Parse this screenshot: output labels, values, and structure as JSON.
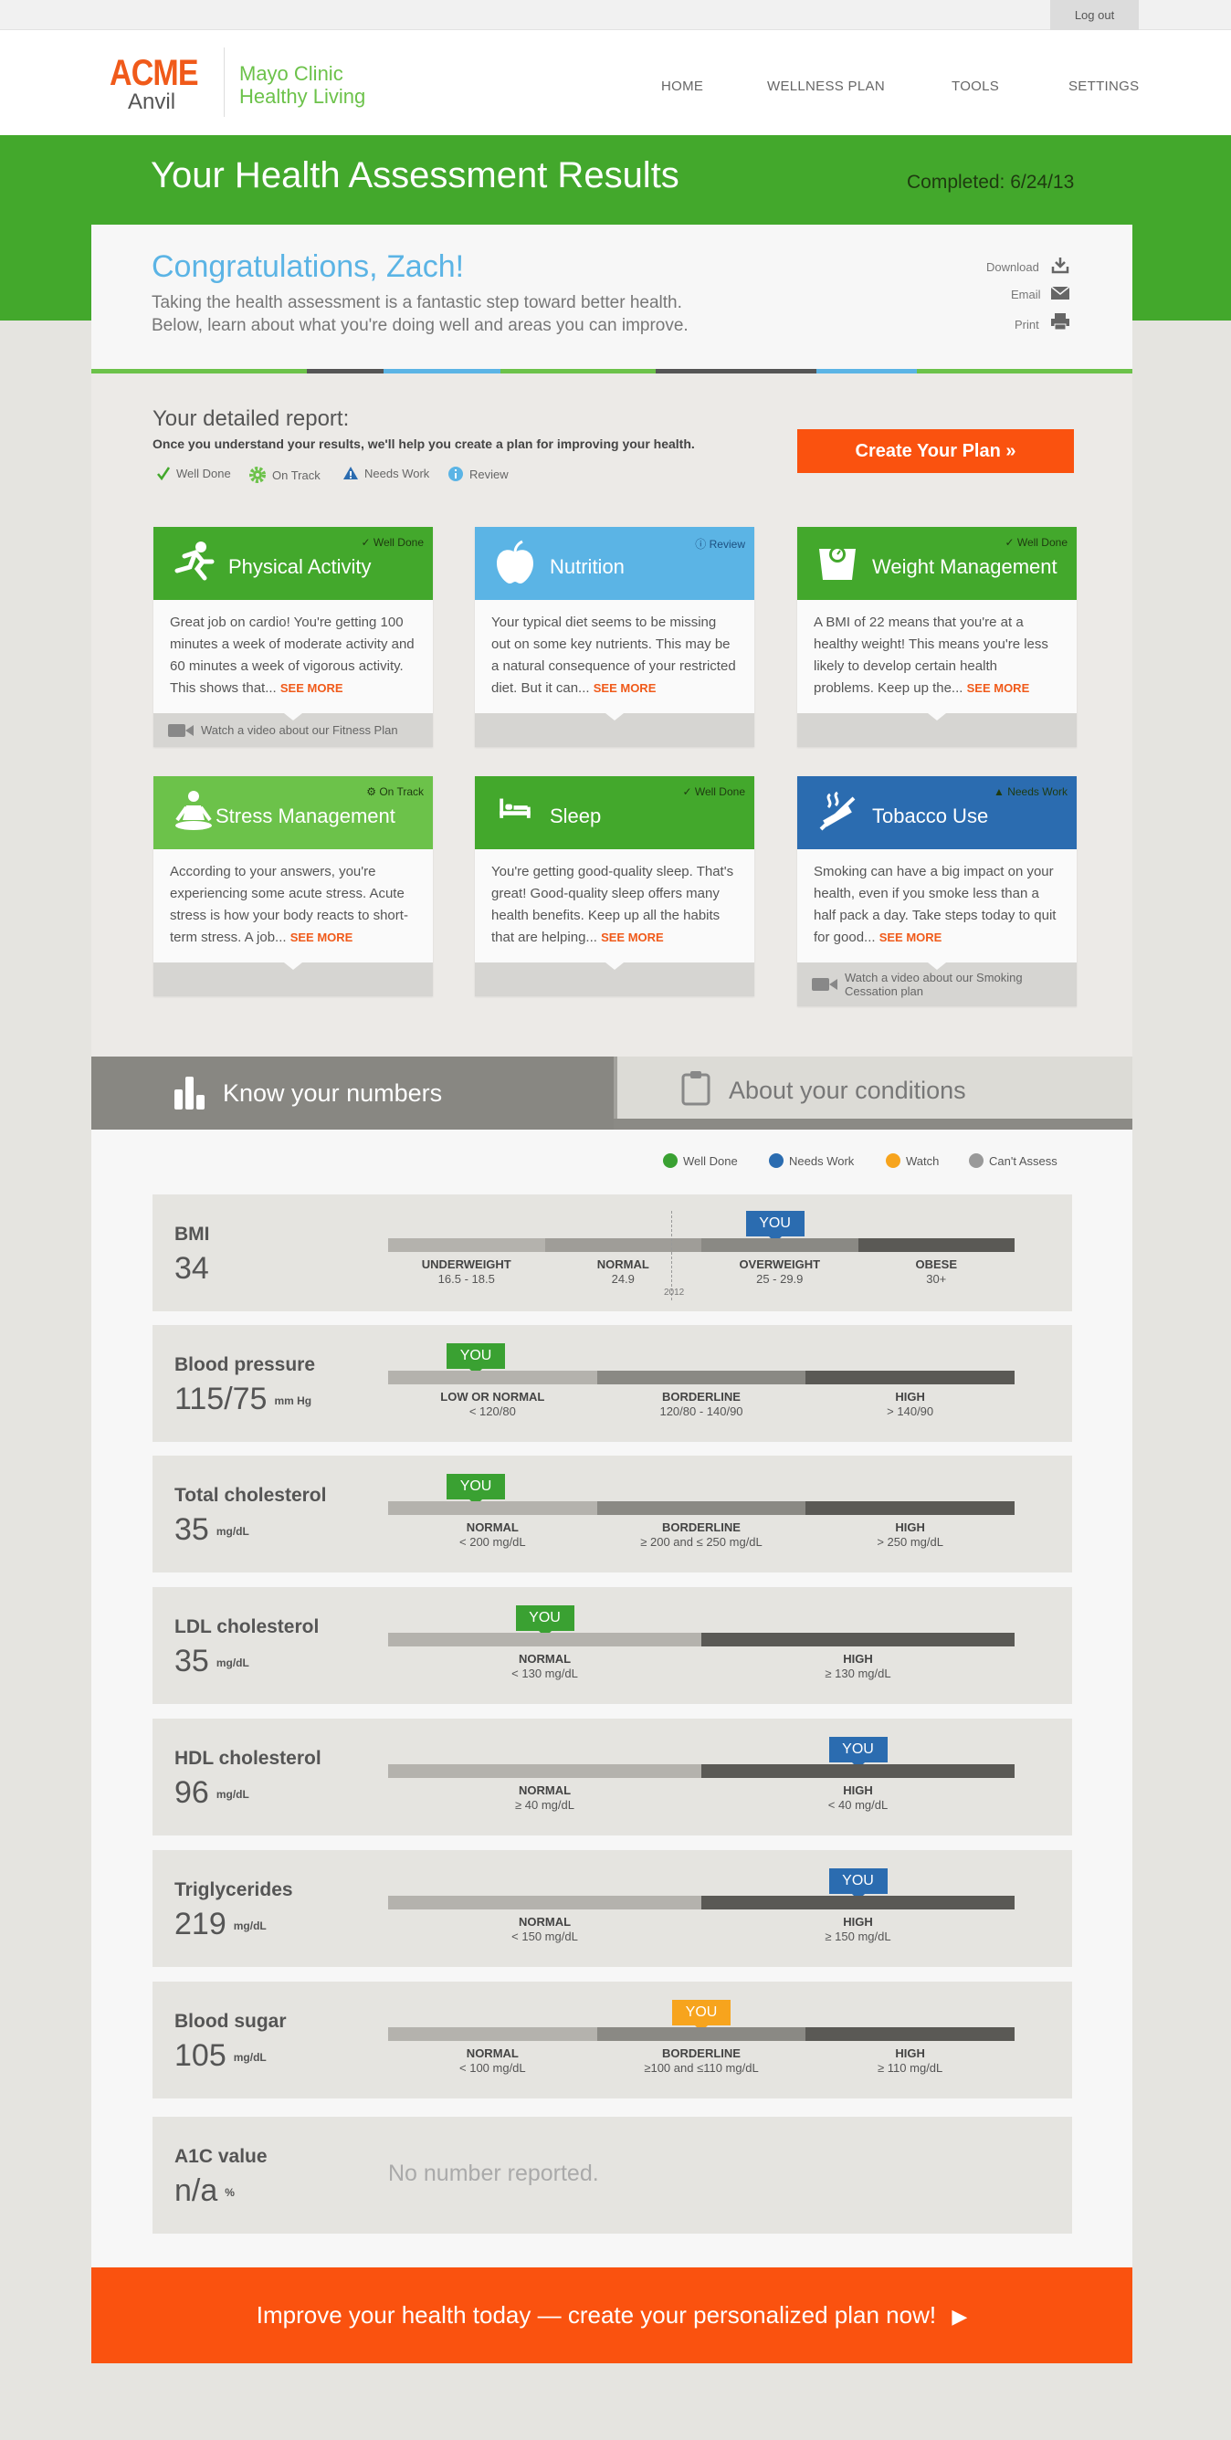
{
  "topbar": {
    "logout": "Log out"
  },
  "brand": {
    "acme": "ACME",
    "anvil": "Anvil",
    "partner_line1": "Mayo Clinic",
    "partner_line2": "Healthy Living"
  },
  "nav": [
    "HOME",
    "WELLNESS PLAN",
    "TOOLS",
    "SETTINGS"
  ],
  "page": {
    "title": "Your Health Assessment Results",
    "completed": "Completed: 6/24/13"
  },
  "intro": {
    "greeting": "Congratulations, Zach!",
    "line1": "Taking the health assessment is a fantastic step toward better health.",
    "line2": "Below, learn about what you're doing well and areas you can improve.",
    "actions": [
      "Download",
      "Email",
      "Print"
    ]
  },
  "report": {
    "title": "Your detailed report:",
    "subtitle": "Once you understand your results, we'll help you create a plan for improving your health.",
    "legend": [
      "Well Done",
      "On Track",
      "Needs Work",
      "Review"
    ],
    "create_button": "Create Your Plan »"
  },
  "topics": [
    {
      "name": "Physical Activity",
      "status": "Well Done",
      "color": "#43a82c",
      "text": "Great job on cardio! You're getting 100 minutes a week of moderate activity and 60 minutes a week of vigorous activity. This shows that...",
      "more": "SEE MORE",
      "video": "Watch a video about our Fitness Plan"
    },
    {
      "name": "Nutrition",
      "status": "Review",
      "color": "#5bb4e5",
      "text": "Your typical diet seems to be missing out on some key nutrients. This may be a natural consequence of your restricted diet. But it can...",
      "more": "SEE MORE",
      "video": ""
    },
    {
      "name": "Weight Management",
      "status": "Well Done",
      "color": "#43a82c",
      "text": "A BMI of 22 means that you're at a healthy weight! This means you're less likely to develop certain health problems. Keep up the...",
      "more": "SEE MORE",
      "video": ""
    },
    {
      "name": "Stress Management",
      "status": "On Track",
      "color": "#6cc24a",
      "text": "According to your answers, you're experiencing some acute stress. Acute stress is how your body reacts to short-term stress. A job...",
      "more": "SEE MORE",
      "video": ""
    },
    {
      "name": "Sleep",
      "status": "Well Done",
      "color": "#43a82c",
      "text": "You're getting good-quality sleep. That's great! Good-quality sleep offers many health benefits. Keep up all the habits that are helping...",
      "more": "SEE MORE",
      "video": ""
    },
    {
      "name": "Tobacco Use",
      "status": "Needs Work",
      "color": "#2b6cb0",
      "text": "Smoking can have a big impact on your health, even if you smoke less than a half pack a day. Take steps today to quit for good...",
      "more": "SEE MORE",
      "video": "Watch a video about our Smoking Cessation plan"
    }
  ],
  "tabs": {
    "numbers": "Know your numbers",
    "conditions": "About your conditions"
  },
  "status_legend": [
    {
      "label": "Well Done",
      "color": "#3aa132"
    },
    {
      "label": "Needs Work",
      "color": "#2b6cb0"
    },
    {
      "label": "Watch",
      "color": "#f7a41d"
    },
    {
      "label": "Can't Assess",
      "color": "#999999"
    }
  ],
  "metrics": [
    {
      "name": "BMI",
      "value": "34",
      "unit": "",
      "you_label": "YOU",
      "you_color": "#2b6cb0",
      "you_segment": 2,
      "segments": [
        {
          "label": "UNDERWEIGHT",
          "range": "16.5 - 18.5",
          "share": 1
        },
        {
          "label": "NORMAL",
          "range": "24.9",
          "share": 1
        },
        {
          "label": "OVERWEIGHT",
          "range": "25 - 29.9",
          "share": 1
        },
        {
          "label": "OBESE",
          "range": "30+",
          "share": 1
        }
      ],
      "marker_label": "2012"
    },
    {
      "name": "Blood pressure",
      "value": "115/75",
      "unit": "mm Hg",
      "you_label": "YOU",
      "you_color": "#3aa132",
      "you_segment": 0,
      "segments": [
        {
          "label": "LOW OR NORMAL",
          "range": "< 120/80",
          "share": 1
        },
        {
          "label": "BORDERLINE",
          "range": "120/80 - 140/90",
          "share": 1
        },
        {
          "label": "HIGH",
          "range": "> 140/90",
          "share": 1
        }
      ]
    },
    {
      "name": "Total cholesterol",
      "value": "35",
      "unit": "mg/dL",
      "you_label": "YOU",
      "you_color": "#3aa132",
      "you_segment": 0,
      "segments": [
        {
          "label": "NORMAL",
          "range": "<  200 mg/dL",
          "share": 1
        },
        {
          "label": "BORDERLINE",
          "range": "≥ 200 and ≤ 250 mg/dL",
          "share": 1
        },
        {
          "label": "HIGH",
          "range": "> 250 mg/dL",
          "share": 1
        }
      ]
    },
    {
      "name": "LDL cholesterol",
      "value": "35",
      "unit": "mg/dL",
      "you_label": "YOU",
      "you_color": "#3aa132",
      "you_segment": 0,
      "segments": [
        {
          "label": "NORMAL",
          "range": "<  130 mg/dL",
          "share": 1
        },
        {
          "label": "HIGH",
          "range": "≥ 130 mg/dL",
          "share": 1
        }
      ]
    },
    {
      "name": "HDL cholesterol",
      "value": "96",
      "unit": "mg/dL",
      "you_label": "YOU",
      "you_color": "#2b6cb0",
      "you_segment": 1,
      "segments": [
        {
          "label": "NORMAL",
          "range": "≥ 40 mg/dL",
          "share": 1
        },
        {
          "label": "HIGH",
          "range": "<  40 mg/dL",
          "share": 1
        }
      ]
    },
    {
      "name": "Triglycerides",
      "value": "219",
      "unit": "mg/dL",
      "you_label": "YOU",
      "you_color": "#2b6cb0",
      "you_segment": 1,
      "segments": [
        {
          "label": "NORMAL",
          "range": "<  150 mg/dL",
          "share": 1
        },
        {
          "label": "HIGH",
          "range": "≥ 150 mg/dL",
          "share": 1
        }
      ]
    },
    {
      "name": "Blood sugar",
      "value": "105",
      "unit": "mg/dL",
      "you_label": "YOU",
      "you_color": "#f7a41d",
      "you_segment": 1,
      "segments": [
        {
          "label": "NORMAL",
          "range": "<  100 mg/dL",
          "share": 1
        },
        {
          "label": "BORDERLINE",
          "range": "≥100 and ≤110 mg/dL",
          "share": 1
        },
        {
          "label": "HIGH",
          "range": "≥ 110 mg/dL",
          "share": 1
        }
      ]
    },
    {
      "name": "A1C value",
      "value": "n/a",
      "unit": "%",
      "none_text": "No number reported."
    }
  ],
  "cta": "Improve your health today — create your personalized plan now!",
  "colors": {
    "green": "#43a82c",
    "orange": "#fa520f",
    "blue": "#5bb4e5",
    "navy": "#2b6cb0"
  }
}
